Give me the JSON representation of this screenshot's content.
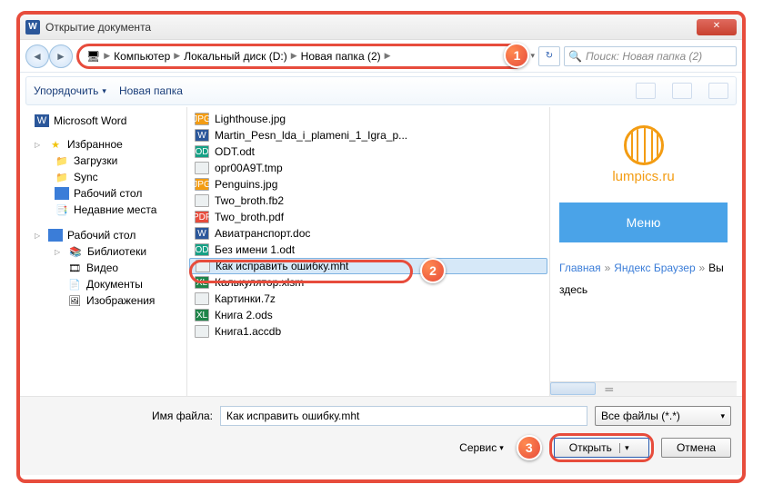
{
  "window": {
    "title": "Открытие документа",
    "close": "✕"
  },
  "breadcrumb": {
    "root_icon": "🖥",
    "c0": "Компьютер",
    "c1": "Локальный диск (D:)",
    "c2": "Новая папка (2)",
    "sep": "▶"
  },
  "search": {
    "placeholder": "Поиск: Новая папка (2)",
    "refresh": "↻",
    "glass": "🔍"
  },
  "toolbar": {
    "organize": "Упорядочить",
    "dd": "▾",
    "newfolder": "Новая папка"
  },
  "sidebar": {
    "word": "Microsoft Word",
    "fav": "Избранное",
    "downloads": "Загрузки",
    "sync": "Sync",
    "desktop": "Рабочий стол",
    "recent": "Недавние места",
    "desktop2": "Рабочий стол",
    "libs": "Библиотеки",
    "video": "Видео",
    "docs": "Документы",
    "pics": "Изображения"
  },
  "files": [
    {
      "icon": "jpg",
      "name": "Lighthouse.jpg"
    },
    {
      "icon": "word",
      "name": "Martin_Pesn_lda_i_plameni_1_Igra_p..."
    },
    {
      "icon": "odt",
      "name": "ODT.odt"
    },
    {
      "icon": "generic",
      "name": "opr00A9T.tmp"
    },
    {
      "icon": "jpg",
      "name": "Penguins.jpg"
    },
    {
      "icon": "generic",
      "name": "Two_broth.fb2"
    },
    {
      "icon": "pdf",
      "name": "Two_broth.pdf"
    },
    {
      "icon": "word",
      "name": "Авиатранспорт.doc"
    },
    {
      "icon": "odt",
      "name": "Без имени 1.odt"
    },
    {
      "icon": "generic",
      "name": "Как исправить ошибку.mht",
      "selected": true
    },
    {
      "icon": "xls",
      "name": "Калькулятор.xlsm"
    },
    {
      "icon": "generic",
      "name": "Картинки.7z"
    },
    {
      "icon": "xls",
      "name": "Книга 2.ods"
    },
    {
      "icon": "generic",
      "name": "Книга1.accdb"
    }
  ],
  "preview": {
    "brand": "lumpics.ru",
    "menu": "Меню",
    "link1": "Главная",
    "link2": "Яндекс Браузер",
    "here": "Вы здесь",
    "gt": "»"
  },
  "footer": {
    "filename_label": "Имя файла:",
    "filename_value": "Как исправить ошибку.mht",
    "filter": "Все файлы (*.*)",
    "tools": "Сервис",
    "open": "Открыть",
    "cancel": "Отмена",
    "dd": "▾",
    "split": "▾"
  },
  "markers": {
    "m1": "1",
    "m2": "2",
    "m3": "3"
  }
}
